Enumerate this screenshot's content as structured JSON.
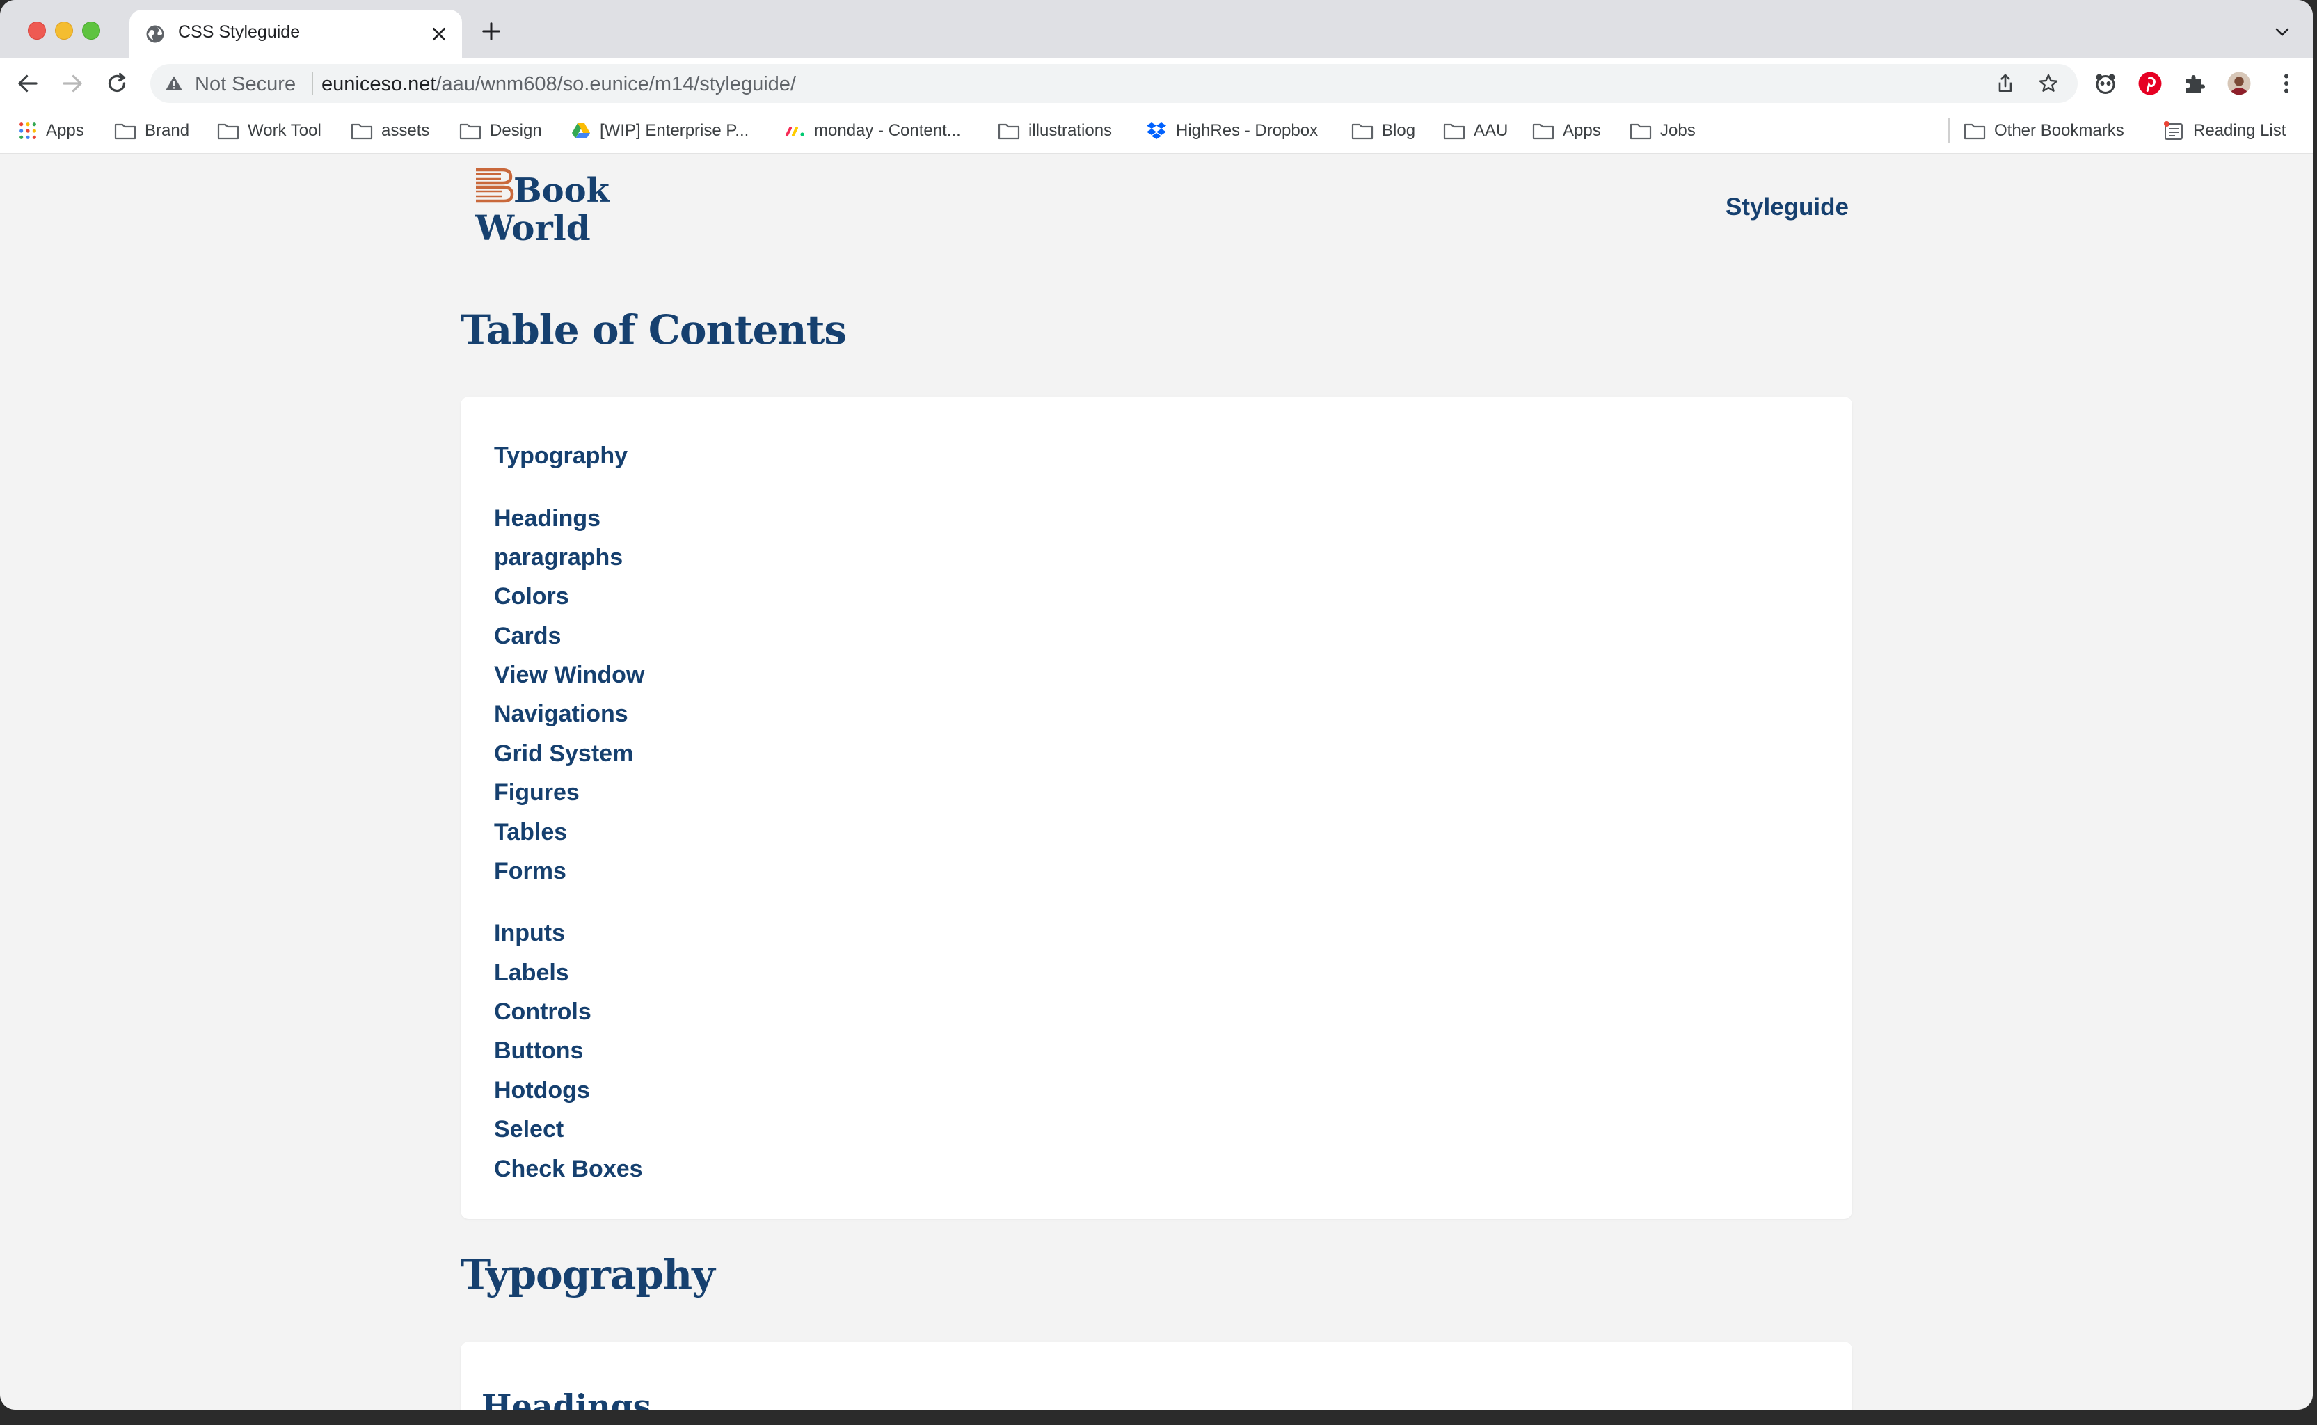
{
  "browser": {
    "tab_title": "CSS Styleguide",
    "security_label": "Not Secure",
    "url_host": "euniceso.net",
    "url_path": "/aau/wnm608/so.eunice/m14/styleguide/"
  },
  "bookmarks": [
    {
      "label": "Apps",
      "icon": "apps-grid-icon"
    },
    {
      "label": "Brand",
      "icon": "folder-icon"
    },
    {
      "label": "Work Tool",
      "icon": "folder-icon"
    },
    {
      "label": "assets",
      "icon": "folder-icon"
    },
    {
      "label": "Design",
      "icon": "folder-icon"
    },
    {
      "label": "[WIP] Enterprise P...",
      "icon": "google-drive-icon"
    },
    {
      "label": "monday - Content...",
      "icon": "monday-icon"
    },
    {
      "label": "illustrations",
      "icon": "folder-icon"
    },
    {
      "label": "HighRes - Dropbox",
      "icon": "dropbox-icon"
    },
    {
      "label": "Blog",
      "icon": "folder-icon"
    },
    {
      "label": "AAU",
      "icon": "folder-icon"
    },
    {
      "label": "Apps",
      "icon": "folder-icon"
    },
    {
      "label": "Jobs",
      "icon": "folder-icon"
    }
  ],
  "bookmarks_right": [
    {
      "label": "Other Bookmarks",
      "icon": "folder-icon"
    },
    {
      "label": "Reading List",
      "icon": "reading-list-icon"
    }
  ],
  "site": {
    "logo_line1": "Book",
    "logo_line2": "World",
    "nav_styleguide": "Styleguide"
  },
  "toc": {
    "heading": "Table of Contents",
    "items": [
      "Typography",
      "Headings",
      "paragraphs",
      "Colors",
      "Cards",
      "View Window",
      "Navigations",
      "Grid System",
      "Figures",
      "Tables",
      "Forms",
      "Inputs",
      "Labels",
      "Controls",
      "Buttons",
      "Hotdogs",
      "Select",
      "Check Boxes"
    ]
  },
  "typography": {
    "heading": "Typography",
    "first_subheading": "Headings"
  },
  "colors": {
    "brand_navy": "#16406f",
    "logo_copper": "#c9683b",
    "page_bg": "#f3f3f3"
  }
}
